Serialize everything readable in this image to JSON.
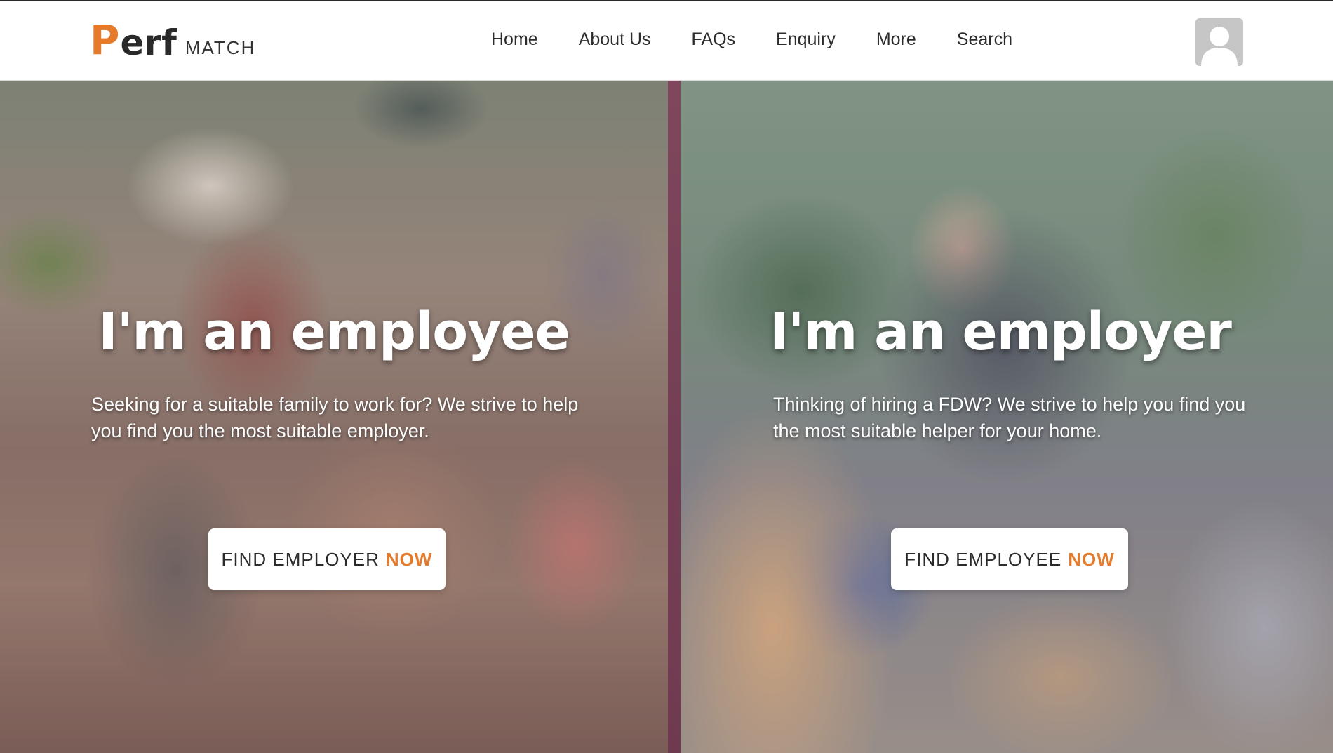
{
  "logo": {
    "p": "P",
    "erf": "erf",
    "match": "MATCH"
  },
  "nav": {
    "items": [
      {
        "label": "Home"
      },
      {
        "label": "About Us"
      },
      {
        "label": "FAQs"
      },
      {
        "label": "Enquiry"
      },
      {
        "label": "More"
      },
      {
        "label": "Search"
      }
    ]
  },
  "account": {
    "icon": "user-avatar-icon"
  },
  "employee_panel": {
    "title": "I'm an employee",
    "description": "Seeking for a suitable family to work for? We strive to help you find you the most suitable employer.",
    "button_label": "FIND EMPLOYER",
    "button_accent": "NOW"
  },
  "employer_panel": {
    "title": "I'm an employer",
    "description": "Thinking of hiring a FDW? We strive to help you find you the most suitable helper for your home.",
    "button_label": "FIND EMPLOYEE",
    "button_accent": "NOW"
  },
  "colors": {
    "accent": "#e57a2a",
    "text_dark": "#2b2b2b",
    "header_bg": "#ffffff"
  }
}
